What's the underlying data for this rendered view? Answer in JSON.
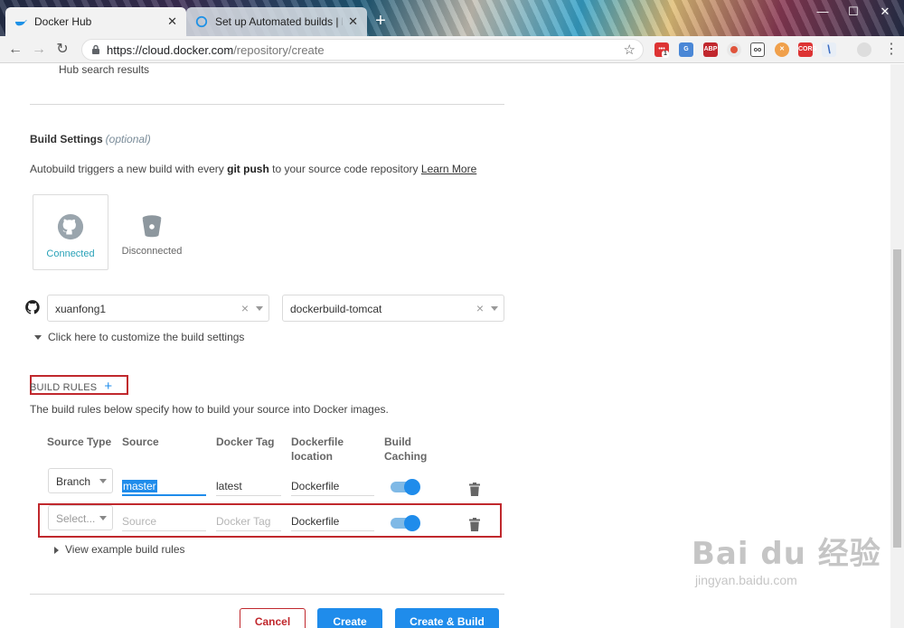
{
  "browser": {
    "tabs": [
      {
        "title": "Docker Hub"
      },
      {
        "title": "Set up Automated builds | Do"
      }
    ],
    "url_host": "https://cloud.docker.com",
    "url_path": "/repository/create",
    "extension_badge": "1"
  },
  "page": {
    "prev_text": "Hub search results",
    "build_settings": {
      "title": "Build Settings",
      "optional": "(optional)",
      "desc_prefix": "Autobuild triggers a new build with every ",
      "desc_bold": "git push",
      "desc_suffix": " to your source code repository ",
      "learn_more": "Learn More"
    },
    "providers": [
      {
        "label": "Connected",
        "icon": "github-icon"
      },
      {
        "label": "Disconnected",
        "icon": "bitbucket-icon"
      }
    ],
    "source": {
      "organization": "xuanfong1",
      "repository": "dockerbuild-tomcat",
      "customize_link": "Click here to customize the build settings"
    },
    "build_rules": {
      "label": "BUILD RULES",
      "add": "+",
      "desc": "The build rules below specify how to build your source into Docker images.",
      "columns": {
        "source_type": "Source Type",
        "source": "Source",
        "docker_tag": "Docker Tag",
        "dockerfile_1": "Dockerfile",
        "dockerfile_2": "location",
        "caching_1": "Build",
        "caching_2": "Caching"
      },
      "rows": [
        {
          "source_type": "Branch",
          "source": "master",
          "docker_tag": "latest",
          "dockerfile": "Dockerfile",
          "caching": true
        },
        {
          "source_type_placeholder": "Select...",
          "source_placeholder": "Source",
          "tag_placeholder": "Docker Tag",
          "dockerfile": "Dockerfile",
          "caching": true
        }
      ],
      "view_examples": "View example build rules"
    },
    "buttons": {
      "cancel": "Cancel",
      "create": "Create",
      "create_build": "Create & Build"
    },
    "colors": {
      "accent": "#1f8ceb",
      "annotation": "#c0282d",
      "connected": "#2aa2b8"
    }
  },
  "watermark": {
    "brand": "Bai du 经验",
    "url": "jingyan.baidu.com"
  }
}
